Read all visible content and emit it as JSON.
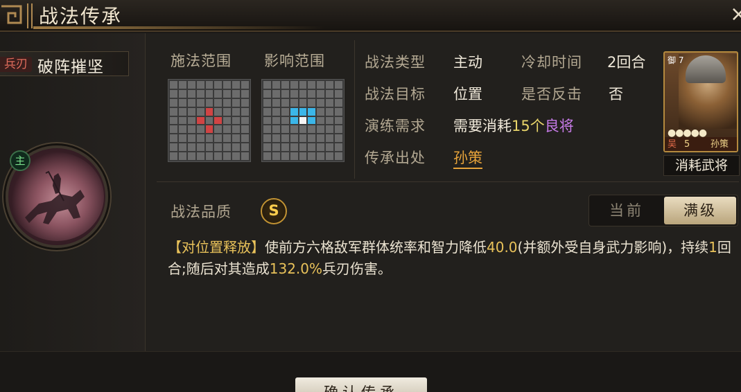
{
  "header": {
    "title": "战法传承",
    "close_glyph": "×"
  },
  "skill": {
    "type_tag": "兵刃",
    "name": "破阵摧坚",
    "portrait_badge": "主"
  },
  "ranges": {
    "cast_label": "施法范围",
    "effect_label": "影响范围",
    "cast_grid_red_cells": [
      [
        3,
        4
      ],
      [
        4,
        3
      ],
      [
        4,
        5
      ],
      [
        5,
        4
      ]
    ],
    "effect_grid_blue_cells": [
      [
        3,
        3
      ],
      [
        3,
        4
      ],
      [
        3,
        5
      ],
      [
        4,
        3
      ],
      [
        4,
        5
      ]
    ],
    "effect_grid_white_cells": [
      [
        4,
        4
      ]
    ]
  },
  "info": {
    "type_label": "战法类型",
    "type_value": "主动",
    "cooldown_label": "冷却时间",
    "cooldown_value": "2回合",
    "target_label": "战法目标",
    "target_value": "位置",
    "counter_label": "是否反击",
    "counter_value": "否",
    "train_label": "演练需求",
    "train_prefix": "需要消耗",
    "train_count": "15个",
    "train_item": "良将",
    "origin_label": "传承出处",
    "origin_value": "孙策"
  },
  "general_card": {
    "side_text": "御 7",
    "stars": "●●●●●",
    "faction": "吴",
    "level": "5",
    "name": "孙策",
    "consume_label": "消耗武将"
  },
  "quality": {
    "label": "战法品质",
    "grade": "S"
  },
  "level_toggle": {
    "current": "当前",
    "max": "满级",
    "selected": "满级"
  },
  "description": {
    "lead": "【对位置释放】",
    "part1": "使前方六格敌军群体统率和智力降低",
    "value1": "40.0",
    "part2": "(并额外受自身武力影响)，持续",
    "value2": "1",
    "part3": "回合;随后对其造成",
    "value3": "132.0%",
    "part4": "兵刃伤害。"
  },
  "footer": {
    "confirm_label": "确认传承"
  }
}
